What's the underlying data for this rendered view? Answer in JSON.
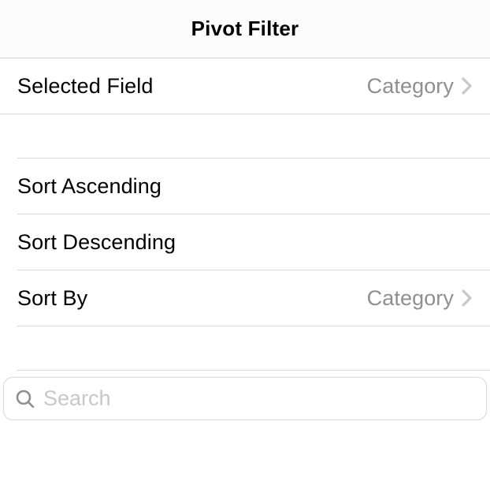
{
  "header": {
    "title": "Pivot Filter"
  },
  "selectedField": {
    "label": "Selected Field",
    "value": "Category"
  },
  "sort": {
    "ascending": "Sort Ascending",
    "descending": "Sort Descending",
    "by": {
      "label": "Sort By",
      "value": "Category"
    }
  },
  "search": {
    "placeholder": "Search"
  }
}
